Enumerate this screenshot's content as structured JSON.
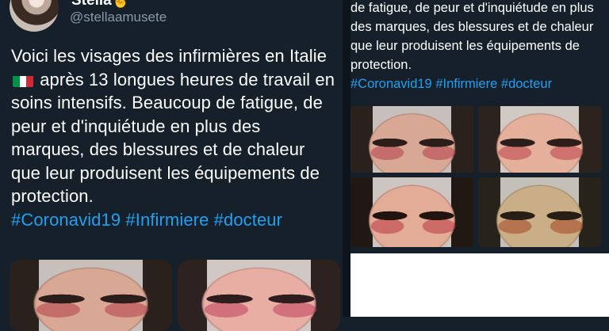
{
  "left_tweet": {
    "display_name_partial": "Stella✌️",
    "handle": "@stellaamusete",
    "text_before_flag": "Voici les visages des infirmières en Italie",
    "text_after_flag": "après 13 longues heures de travail en soins intensifs. Beaucoup de fatigue, de peur et d'inquiétude en plus des marques, des blessures et de chaleur que leur produisent les équipements de protection.",
    "hashtags": [
      "#Coronavid19",
      "#Infirmiere",
      "#docteur"
    ],
    "flag_colors": [
      "#009246",
      "#ffffff",
      "#ce2b37"
    ]
  },
  "right_tweet": {
    "text": "de fatigue, de peur et d'inquiétude en plus des marques, des blessures et de chaleur que leur produisent les équipements de protection.",
    "hashtags": [
      "#Coronavid19",
      "#Infirmiere",
      "#docteur"
    ]
  },
  "colors": {
    "background": "#15202b",
    "link": "#1da1f2",
    "secondary_text": "#8899a6"
  }
}
